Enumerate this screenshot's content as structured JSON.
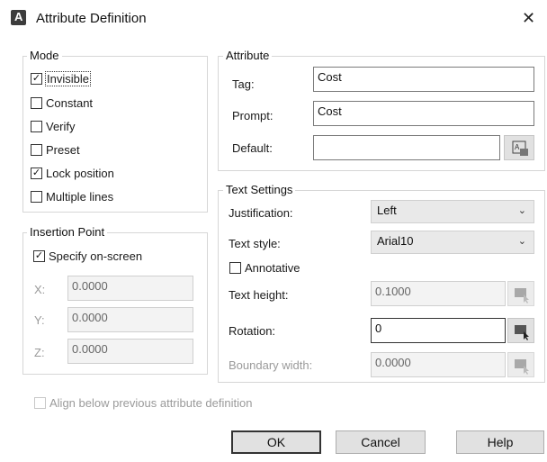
{
  "window": {
    "title": "Attribute Definition",
    "close_glyph": "✕",
    "app_icon_letter": "A"
  },
  "mode": {
    "legend": "Mode",
    "items": [
      {
        "label": "Invisible",
        "checked": true
      },
      {
        "label": "Constant",
        "checked": false
      },
      {
        "label": "Verify",
        "checked": false
      },
      {
        "label": "Preset",
        "checked": false
      },
      {
        "label": "Lock position",
        "checked": true
      },
      {
        "label": "Multiple lines",
        "checked": false
      }
    ]
  },
  "attribute": {
    "legend": "Attribute",
    "tag_label": "Tag:",
    "tag_value": "Cost",
    "prompt_label": "Prompt:",
    "prompt_value": "Cost",
    "default_label": "Default:",
    "default_value": ""
  },
  "insertion_point": {
    "legend": "Insertion Point",
    "specify_label": "Specify on-screen",
    "specify_checked": true,
    "x_label": "X:",
    "x_value": "0.0000",
    "y_label": "Y:",
    "y_value": "0.0000",
    "z_label": "Z:",
    "z_value": "0.0000"
  },
  "text_settings": {
    "legend": "Text Settings",
    "justification_label": "Justification:",
    "justification_value": "Left",
    "text_style_label": "Text style:",
    "text_style_value": "Arial10",
    "annotative_label": "Annotative",
    "annotative_checked": false,
    "text_height_label": "Text height:",
    "text_height_value": "0.1000",
    "rotation_label": "Rotation:",
    "rotation_value": "0",
    "boundary_width_label": "Boundary width:",
    "boundary_width_value": "0.0000"
  },
  "align_below": {
    "label": "Align below previous attribute definition",
    "checked": false
  },
  "buttons": {
    "ok": "OK",
    "cancel": "Cancel",
    "help": "Help"
  }
}
